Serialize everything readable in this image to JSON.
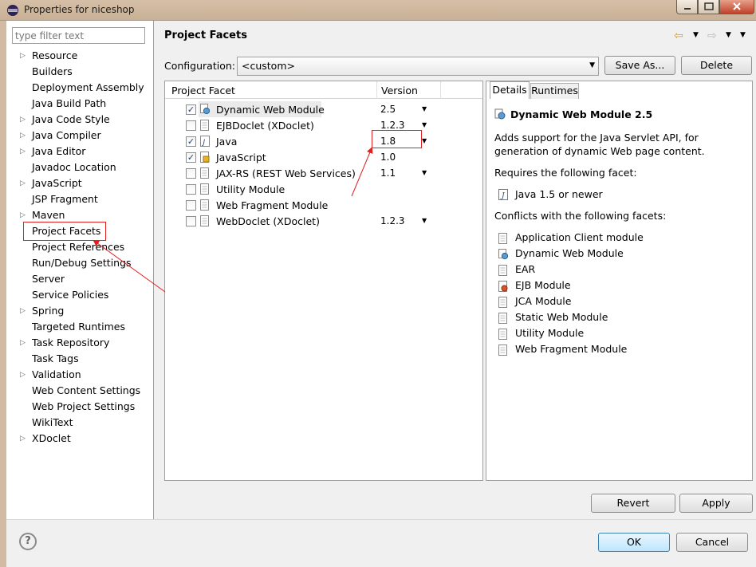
{
  "window": {
    "title": "Properties for niceshop"
  },
  "filter": {
    "placeholder": "type filter text"
  },
  "sidebar": {
    "items": [
      {
        "label": "Resource",
        "expandable": true
      },
      {
        "label": "Builders",
        "expandable": false
      },
      {
        "label": "Deployment Assembly",
        "expandable": false
      },
      {
        "label": "Java Build Path",
        "expandable": false
      },
      {
        "label": "Java Code Style",
        "expandable": true
      },
      {
        "label": "Java Compiler",
        "expandable": true
      },
      {
        "label": "Java Editor",
        "expandable": true
      },
      {
        "label": "Javadoc Location",
        "expandable": false
      },
      {
        "label": "JavaScript",
        "expandable": true
      },
      {
        "label": "JSP Fragment",
        "expandable": false
      },
      {
        "label": "Maven",
        "expandable": true
      },
      {
        "label": "Project Facets",
        "expandable": false,
        "selected": true
      },
      {
        "label": "Project References",
        "expandable": false
      },
      {
        "label": "Run/Debug Settings",
        "expandable": false
      },
      {
        "label": "Server",
        "expandable": false
      },
      {
        "label": "Service Policies",
        "expandable": false
      },
      {
        "label": "Spring",
        "expandable": true
      },
      {
        "label": "Targeted Runtimes",
        "expandable": false
      },
      {
        "label": "Task Repository",
        "expandable": true
      },
      {
        "label": "Task Tags",
        "expandable": false
      },
      {
        "label": "Validation",
        "expandable": true
      },
      {
        "label": "Web Content Settings",
        "expandable": false
      },
      {
        "label": "Web Project Settings",
        "expandable": false
      },
      {
        "label": "WikiText",
        "expandable": false
      },
      {
        "label": "XDoclet",
        "expandable": true
      }
    ]
  },
  "page": {
    "title": "Project Facets"
  },
  "config": {
    "label": "Configuration:",
    "value": "<custom>",
    "save_as": "Save As...",
    "delete": "Delete"
  },
  "facets": {
    "col_facet": "Project Facet",
    "col_version": "Version",
    "rows": [
      {
        "name": "Dynamic Web Module",
        "version": "2.5",
        "checked": true,
        "icon": "web-module-icon",
        "dropdown": true
      },
      {
        "name": "EJBDoclet (XDoclet)",
        "version": "1.2.3",
        "checked": false,
        "icon": "page-icon",
        "dropdown": true
      },
      {
        "name": "Java",
        "version": "1.8",
        "checked": true,
        "icon": "java-icon",
        "dropdown": true
      },
      {
        "name": "JavaScript",
        "version": "1.0",
        "checked": true,
        "icon": "javascript-icon",
        "dropdown": false
      },
      {
        "name": "JAX-RS (REST Web Services)",
        "version": "1.1",
        "checked": false,
        "icon": "page-icon",
        "dropdown": true
      },
      {
        "name": "Utility Module",
        "version": "",
        "checked": false,
        "icon": "page-icon",
        "dropdown": false
      },
      {
        "name": "Web Fragment Module",
        "version": "",
        "checked": false,
        "icon": "page-icon",
        "dropdown": false
      },
      {
        "name": "WebDoclet (XDoclet)",
        "version": "1.2.3",
        "checked": false,
        "icon": "page-icon",
        "dropdown": true
      }
    ]
  },
  "details": {
    "tab_details": "Details",
    "tab_runtimes": "Runtimes",
    "title": "Dynamic Web Module 2.5",
    "description": "Adds support for the Java Servlet API, for generation of dynamic Web page content.",
    "requires_label": "Requires the following facet:",
    "requires_item": "Java 1.5 or newer",
    "conflicts_label": "Conflicts with the following facets:",
    "conflicts": [
      {
        "label": "Application Client module",
        "icon": "page-icon"
      },
      {
        "label": "Dynamic Web Module",
        "icon": "web-module-icon"
      },
      {
        "label": "EAR",
        "icon": "page-icon"
      },
      {
        "label": "EJB Module",
        "icon": "ejb-icon"
      },
      {
        "label": "JCA Module",
        "icon": "page-icon"
      },
      {
        "label": "Static Web Module",
        "icon": "page-icon"
      },
      {
        "label": "Utility Module",
        "icon": "page-icon"
      },
      {
        "label": "Web Fragment Module",
        "icon": "page-icon"
      }
    ]
  },
  "buttons": {
    "revert": "Revert",
    "apply": "Apply",
    "ok": "OK",
    "cancel": "Cancel",
    "help": "?"
  },
  "colors": {
    "annotation": "#e02020",
    "selection_border": "#e02020"
  }
}
